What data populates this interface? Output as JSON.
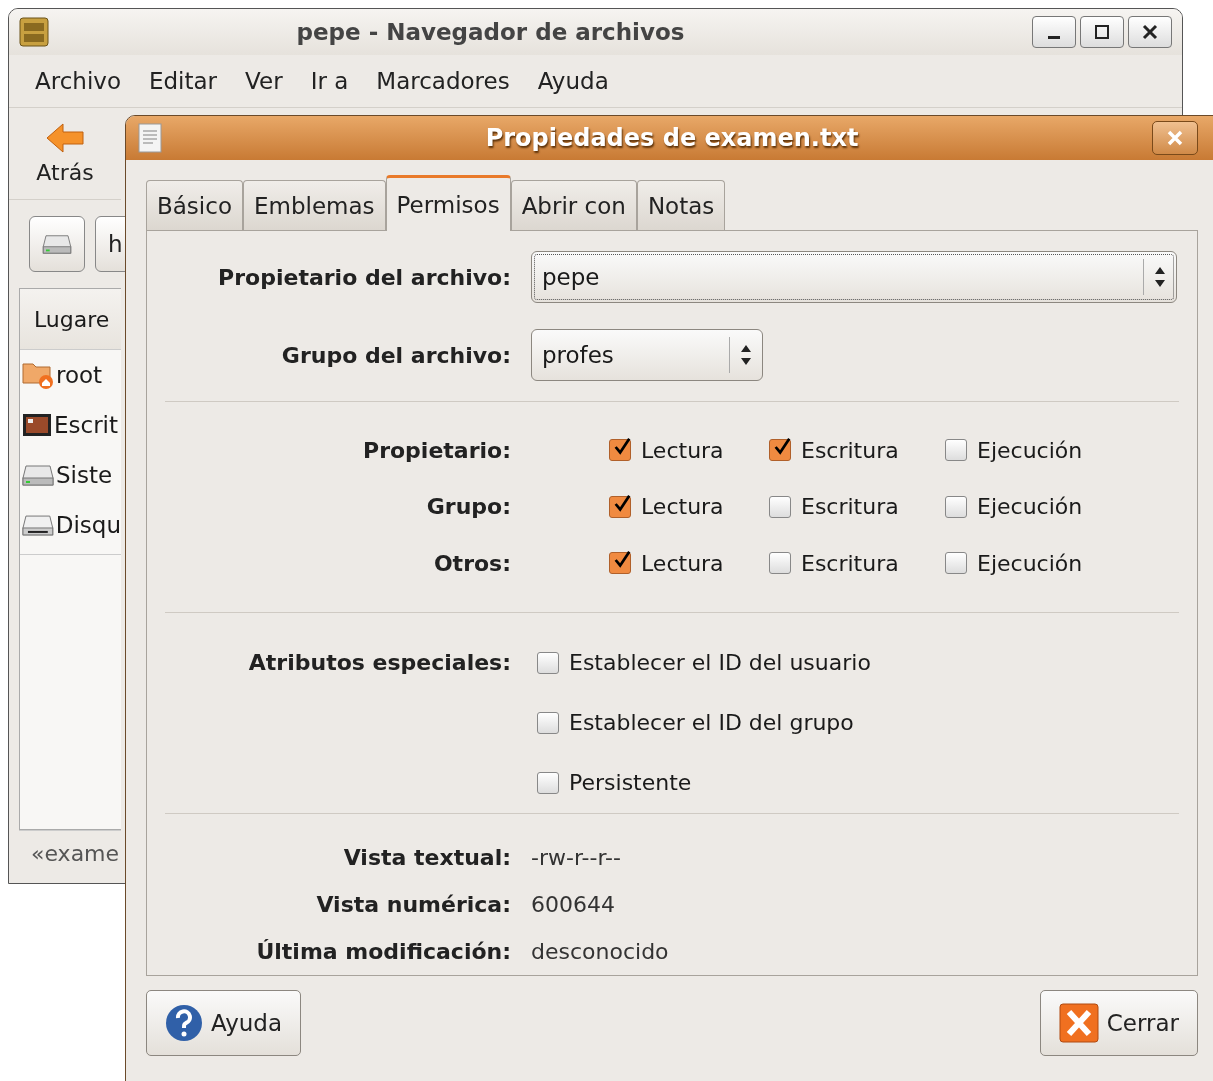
{
  "file_manager": {
    "title": "pepe - Navegador de archivos",
    "menu": [
      "Archivo",
      "Editar",
      "Ver",
      "Ir a",
      "Marcadores",
      "Ayuda"
    ],
    "back_button": {
      "label": "Atrás"
    },
    "location": {
      "text": "h"
    },
    "sidebar": {
      "header": "Lugare",
      "items": [
        {
          "label": "root",
          "kind": "home"
        },
        {
          "label": "Escrit",
          "kind": "desktop"
        },
        {
          "label": "Siste",
          "kind": "drive"
        },
        {
          "label": "Disqu",
          "kind": "floppy"
        }
      ]
    },
    "status_bar": "«exame"
  },
  "dialog": {
    "title": "Propiedades de examen.txt",
    "tabs": [
      {
        "label": "Básico",
        "selected": false
      },
      {
        "label": "Emblemas",
        "selected": false
      },
      {
        "label": "Permisos",
        "selected": true
      },
      {
        "label": "Abrir con",
        "selected": false
      },
      {
        "label": "Notas",
        "selected": false
      }
    ],
    "owner": {
      "label": "Propietario del archivo:",
      "value": "pepe",
      "focused": true
    },
    "group": {
      "label": "Grupo del archivo:",
      "value": "profes",
      "focused": false
    },
    "permissions": [
      {
        "label": "Propietario:",
        "options": [
          {
            "label": "Lectura",
            "checked": true
          },
          {
            "label": "Escritura",
            "checked": true
          },
          {
            "label": "Ejecución",
            "checked": false
          }
        ]
      },
      {
        "label": "Grupo:",
        "options": [
          {
            "label": "Lectura",
            "checked": true
          },
          {
            "label": "Escritura",
            "checked": false
          },
          {
            "label": "Ejecución",
            "checked": false
          }
        ]
      },
      {
        "label": "Otros:",
        "options": [
          {
            "label": "Lectura",
            "checked": true
          },
          {
            "label": "Escritura",
            "checked": false
          },
          {
            "label": "Ejecución",
            "checked": false
          }
        ]
      }
    ],
    "special": {
      "label": "Atributos especiales:",
      "options": [
        {
          "label": "Establecer el ID del usuario",
          "checked": false
        },
        {
          "label": "Establecer el ID del grupo",
          "checked": false
        },
        {
          "label": "Persistente",
          "checked": false
        }
      ]
    },
    "info": [
      {
        "label": "Vista textual:",
        "value": "-rw-r--r--"
      },
      {
        "label": "Vista numérica:",
        "value": "600644"
      },
      {
        "label": "Última modificación:",
        "value": "desconocido"
      }
    ],
    "buttons": [
      {
        "label": "Ayuda",
        "kind": "help"
      },
      {
        "label": "Cerrar",
        "kind": "close"
      }
    ]
  }
}
